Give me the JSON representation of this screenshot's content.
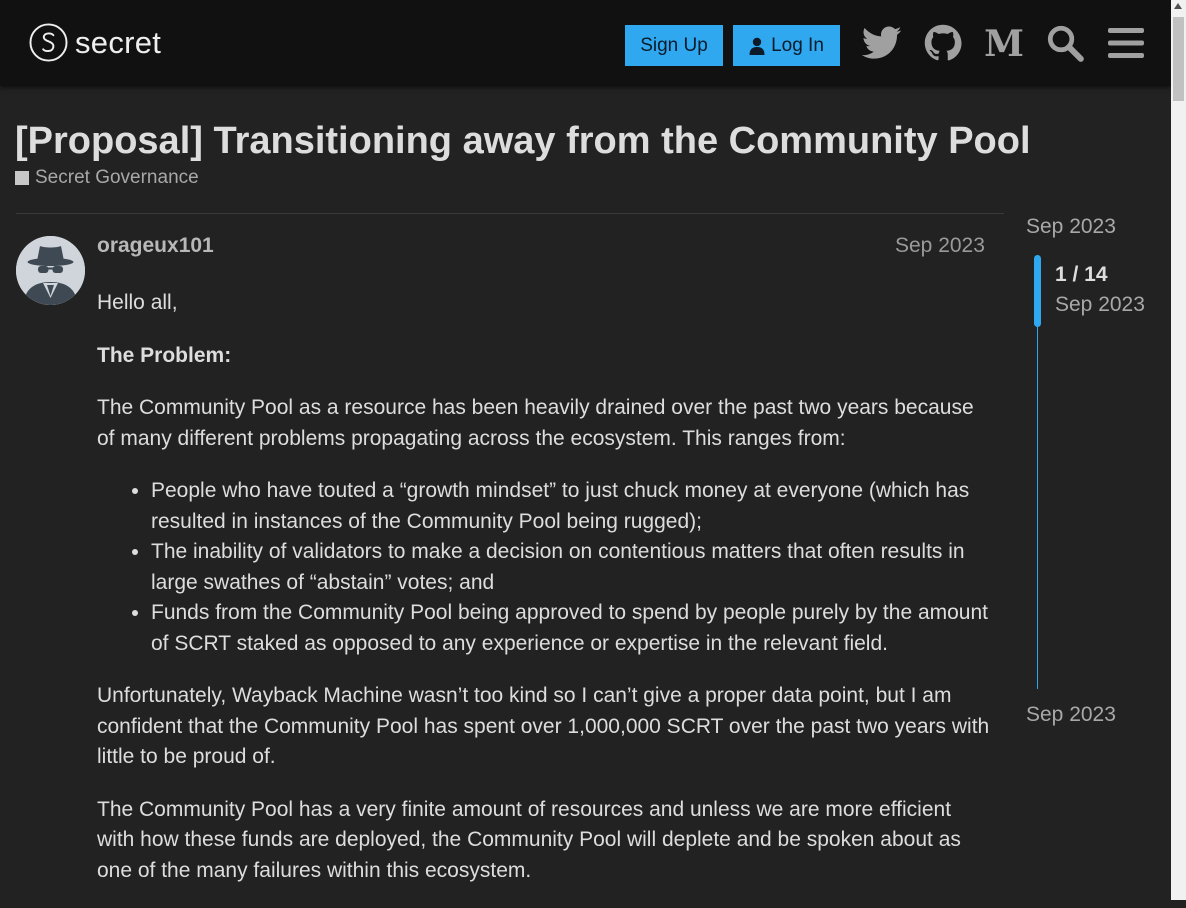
{
  "header": {
    "logo_text": "secret",
    "signup_label": "Sign Up",
    "login_label": "Log In",
    "icons": [
      "twitter-icon",
      "github-icon",
      "medium-icon",
      "search-icon",
      "hamburger-menu-icon"
    ]
  },
  "topic": {
    "title": "[Proposal] Transitioning away from the Community Pool",
    "category": "Secret Governance"
  },
  "post": {
    "username": "orageux101",
    "date": "Sep 2023",
    "greeting": "Hello all,",
    "problem_heading": "The Problem:",
    "para1": "The Community Pool as a resource has been heavily drained over the past two years because of many different problems propagating across the ecosystem. This ranges from:",
    "bullets": [
      "People who have touted a “growth mindset” to just chuck money at everyone (which has resulted in instances of the Community Pool being rugged);",
      "The inability of validators to make a decision on contentious matters that often results in large swathes of “abstain” votes; and",
      "Funds from the Community Pool being approved to spend by people purely by the amount of SCRT staked as opposed to any experience or expertise in the relevant field."
    ],
    "para2": "Unfortunately, Wayback Machine wasn’t too kind so I can’t give a proper data point, but I am confident that the Community Pool has spent over 1,000,000 SCRT over the past two years with little to be proud of.",
    "para3": "The Community Pool has a very finite amount of resources and unless we are more efficient with how these funds are deployed, the Community Pool will deplete and be spoken about as one of the many failures within this ecosystem."
  },
  "timeline": {
    "start_date": "Sep 2023",
    "position": "1 / 14",
    "position_date": "Sep 2023",
    "end_date": "Sep 2023"
  },
  "colors": {
    "accent": "#2fa8f0",
    "header_bg": "#111111",
    "page_bg": "#222222"
  }
}
